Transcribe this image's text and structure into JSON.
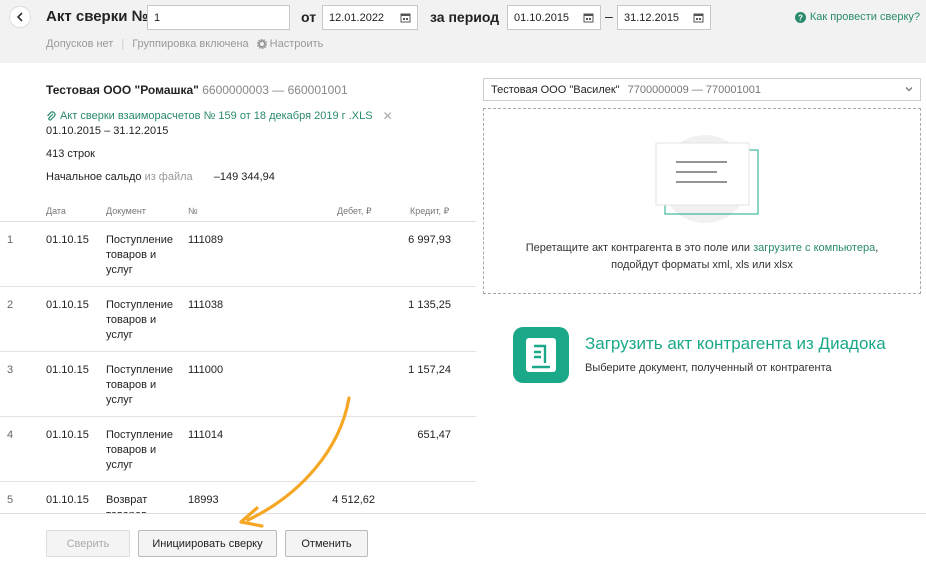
{
  "header": {
    "title": "Акт сверки №",
    "number_value": "1",
    "from_label": "от",
    "date_value": "12.01.2022",
    "period_label": "за период",
    "period_start": "01.10.2015",
    "period_dash": "–",
    "period_end": "31.12.2015",
    "help_link": "Как провести сверку?"
  },
  "subbar": {
    "access": "Допусков нет",
    "grouping": "Группировка включена",
    "settings": "Настроить"
  },
  "left": {
    "org_name": "Тестовая ООО \"Ромашка\"",
    "org_ids": "6600000003 — 660001001",
    "file_name": "Акт сверки взаиморасчетов № 159 от 18 декабря 2019 г .XLS",
    "period": "01.10.2015 – 31.12.2015",
    "rows_count": "413 строк",
    "saldo_label": "Начальное сальдо",
    "saldo_source": "из файла",
    "saldo_value": "–149 344,94"
  },
  "table": {
    "columns": [
      "Дата",
      "Документ",
      "№",
      "Дебет, ₽",
      "Кредит, ₽"
    ],
    "rows": [
      {
        "n": "1",
        "date": "01.10.15",
        "doc": "Поступление товаров и услуг",
        "no": "111089",
        "debit": "",
        "credit": "6 997,93"
      },
      {
        "n": "2",
        "date": "01.10.15",
        "doc": "Поступление товаров и услуг",
        "no": "111038",
        "debit": "",
        "credit": "1 135,25"
      },
      {
        "n": "3",
        "date": "01.10.15",
        "doc": "Поступление товаров и услуг",
        "no": "111000",
        "debit": "",
        "credit": "1 157,24"
      },
      {
        "n": "4",
        "date": "01.10.15",
        "doc": "Поступление товаров и услуг",
        "no": "111014",
        "debit": "",
        "credit": "651,47"
      },
      {
        "n": "5",
        "date": "01.10.15",
        "doc": "Возврат товаров",
        "no": "18993",
        "debit": "4 512,62",
        "credit": ""
      }
    ]
  },
  "right": {
    "counterparty_name": "Тестовая ООО \"Василек\"",
    "counterparty_ids": "7700000009 — 770001001",
    "drop_text_1": "Перетащите акт контрагента в это поле или",
    "drop_link": "загрузите с компьютера",
    "drop_text_2": "подойдут форматы xml, xls или xlsx",
    "diadoc_title": "Загрузить акт контрагента из Диадока",
    "diadoc_sub": "Выберите документ, полученный от контрагента"
  },
  "buttons": {
    "reconcile": "Сверить",
    "initiate": "Инициировать сверку",
    "cancel": "Отменить"
  },
  "colors": {
    "accent": "#1aa889",
    "link": "#2a8a6e",
    "arrow": "#f5a623"
  }
}
